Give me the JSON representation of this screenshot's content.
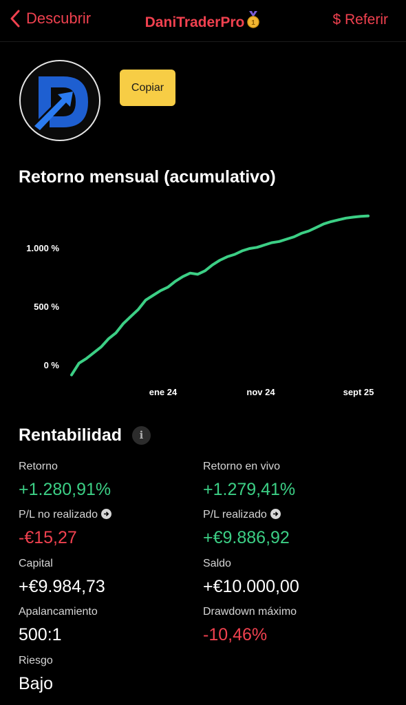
{
  "nav": {
    "back_label": "Descubrir",
    "title": "DaniTraderPro",
    "medal_icon": "medal-icon",
    "refer_label": "$ Referir"
  },
  "profile": {
    "avatar_icon": "logo-d-arrow",
    "copy_label": "Copiar"
  },
  "chart_section": {
    "title": "Retorno mensual (acumulativo)"
  },
  "chart_data": {
    "type": "line",
    "title": "Retorno mensual (acumulativo)",
    "y_tick_labels": [
      "0 %",
      "500 %",
      "1.000 %"
    ],
    "y_ticks": [
      0,
      500,
      1000
    ],
    "x_tick_labels": [
      "ene 24",
      "nov 24",
      "sept 25"
    ],
    "ylim": [
      -100,
      1300
    ],
    "series": [
      {
        "color": "#3ccf85",
        "values": [
          -80,
          20,
          60,
          110,
          160,
          230,
          280,
          360,
          420,
          480,
          560,
          600,
          640,
          670,
          720,
          760,
          790,
          780,
          810,
          860,
          900,
          930,
          950,
          980,
          1000,
          1010,
          1030,
          1050,
          1060,
          1080,
          1100,
          1130,
          1150,
          1180,
          1210,
          1230,
          1245,
          1260,
          1268,
          1275,
          1279
        ]
      }
    ]
  },
  "rentabilidad": {
    "title": "Rentabilidad",
    "retorno_label": "Retorno",
    "retorno_value": "+1.280,91%",
    "retorno_vivo_label": "Retorno en vivo",
    "retorno_vivo_value": "+1.279,41%",
    "pl_no_label": "P/L no realizado",
    "pl_no_value": "-€15,27",
    "pl_real_label": "P/L realizado",
    "pl_real_value": "+€9.886,92",
    "capital_label": "Capital",
    "capital_value": "+€9.984,73",
    "saldo_label": "Saldo",
    "saldo_value": "+€10.000,00",
    "apal_label": "Apalancamiento",
    "apal_value": "500:1",
    "drawdown_label": "Drawdown máximo",
    "drawdown_value": "-10,46%",
    "riesgo_label": "Riesgo",
    "riesgo_value": "Bajo"
  },
  "colors": {
    "accent": "#f0414f",
    "positive": "#3ccf85",
    "button": "#f7cd45"
  }
}
